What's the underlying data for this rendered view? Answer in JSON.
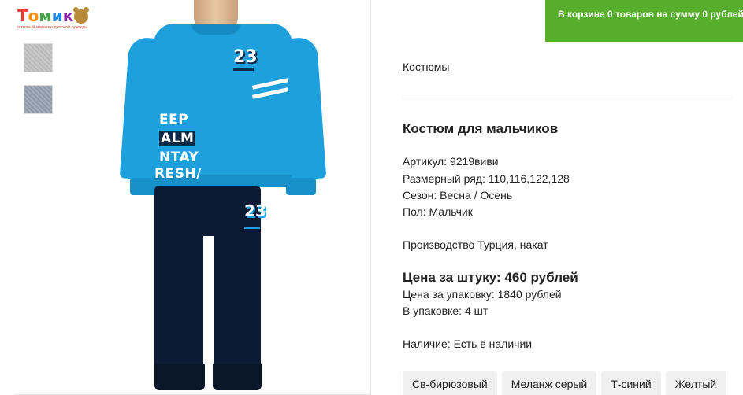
{
  "logo": {
    "letters": [
      "Т",
      "о",
      "м",
      "и",
      "к",
      "о"
    ],
    "letter_colors": [
      "#e53935",
      "#fb8c00",
      "#43a047",
      "#1e88e5",
      "#8e24aa",
      "#e53935"
    ],
    "tagline": "оптовый магазин детской одежды"
  },
  "cart": {
    "prefix": "В корзине ",
    "count": "0",
    "middle": " товаров на сумму ",
    "sum": "0",
    "suffix": " рублей",
    "background": "#57ad2c"
  },
  "breadcrumb": "Костюмы",
  "product": {
    "title": "Костюм для мальчиков",
    "article": "Артикул: 9219виви",
    "sizes": "Размерный ряд: 110,116,122,128",
    "season": "Сезон: Весна / Осень",
    "gender": "Пол: Мальчик",
    "production": "Производство Турция, накат",
    "price_unit": "Цена за штуку: 460 рублей",
    "price_pack": "Цена за упаковку: 1840 рублей",
    "pack_qty": "В упаковке: 4 шт",
    "availability": "Наличие: Есть в наличии"
  },
  "garment_print": {
    "number": "23",
    "line1": "EEP",
    "line2": "ALM",
    "line3": "NTAY",
    "line4": "RESH/",
    "leg_number": "23"
  },
  "colors": [
    "Св-бирюзовый",
    "Меланж серый",
    "Т-синий",
    "Желтый"
  ]
}
